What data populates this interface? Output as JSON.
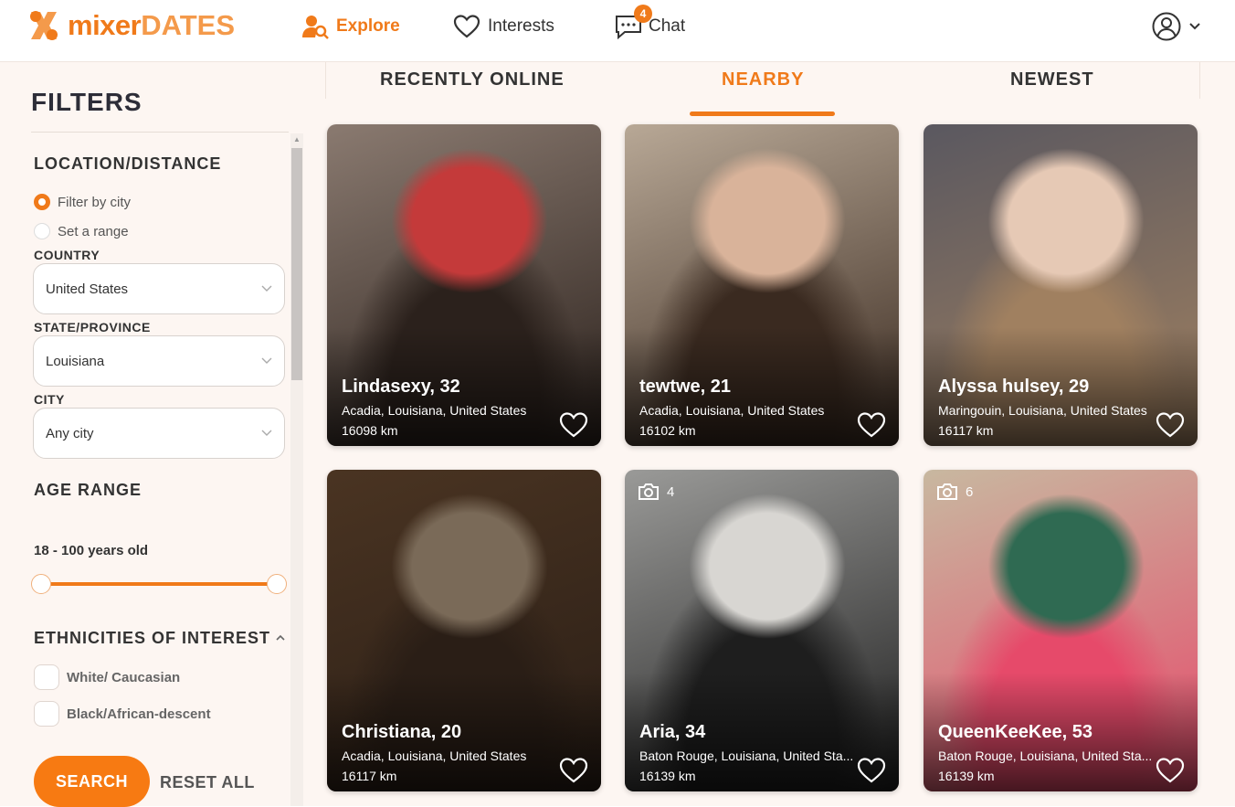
{
  "brand": {
    "name_part1": "mixer",
    "name_part2": "DATES",
    "accent": "#f07a1a"
  },
  "nav": {
    "explore": "Explore",
    "interests": "Interests",
    "chat": "Chat",
    "chat_badge": "4"
  },
  "sidebar": {
    "title": "FILTERS",
    "location": {
      "title": "LOCATION/DISTANCE",
      "option_city": "Filter by city",
      "option_range": "Set a range",
      "country_label": "COUNTRY",
      "country_value": "United States",
      "state_label": "STATE/PROVINCE",
      "state_value": "Louisiana",
      "city_label": "CITY",
      "city_value": "Any city"
    },
    "age": {
      "title": "AGE RANGE",
      "value": "18 - 100 years old",
      "min": 18,
      "max": 100
    },
    "ethnicities": {
      "title": "ETHNICITIES OF INTEREST",
      "options": [
        "White/ Caucasian",
        "Black/African-descent"
      ]
    },
    "search_label": "SEARCH",
    "reset_label": "RESET ALL"
  },
  "tabs": [
    "RECENTLY ONLINE",
    "NEARBY",
    "NEWEST"
  ],
  "active_tab": "NEARBY",
  "profiles": [
    {
      "name": "Lindasexy, 32",
      "location": "Acadia, Louisiana, United States",
      "distance": "16098 km",
      "photos": null,
      "colors": [
        "#8a7a70",
        "#c43a3a",
        "#2b211c"
      ]
    },
    {
      "name": "tewtwe, 21",
      "location": "Acadia, Louisiana, United States",
      "distance": "16102 km",
      "photos": null,
      "colors": [
        "#b8a896",
        "#d9b39a",
        "#3a2a20"
      ]
    },
    {
      "name": "Alyssa hulsey, 29",
      "location": "Maringouin, Louisiana, United States",
      "distance": "16117 km",
      "photos": null,
      "colors": [
        "#5a5860",
        "#e6c9b5",
        "#a08060"
      ]
    },
    {
      "name": "Christiana, 20",
      "location": "Acadia, Louisiana, United States",
      "distance": "16117 km",
      "photos": null,
      "colors": [
        "#4a3422",
        "#7a6a58",
        "#2a1e16"
      ]
    },
    {
      "name": "Aria, 34",
      "location": "Baton Rouge, Louisiana, United Sta...",
      "distance": "16139 km",
      "photos": "4",
      "colors": [
        "#9a9a98",
        "#d8d6d2",
        "#1e1e1e"
      ]
    },
    {
      "name": "QueenKeeKee, 53",
      "location": "Baton Rouge, Louisiana, United Sta...",
      "distance": "16139 km",
      "photos": "6",
      "colors": [
        "#c8b8a0",
        "#2f6a52",
        "#e64a6a"
      ]
    }
  ]
}
